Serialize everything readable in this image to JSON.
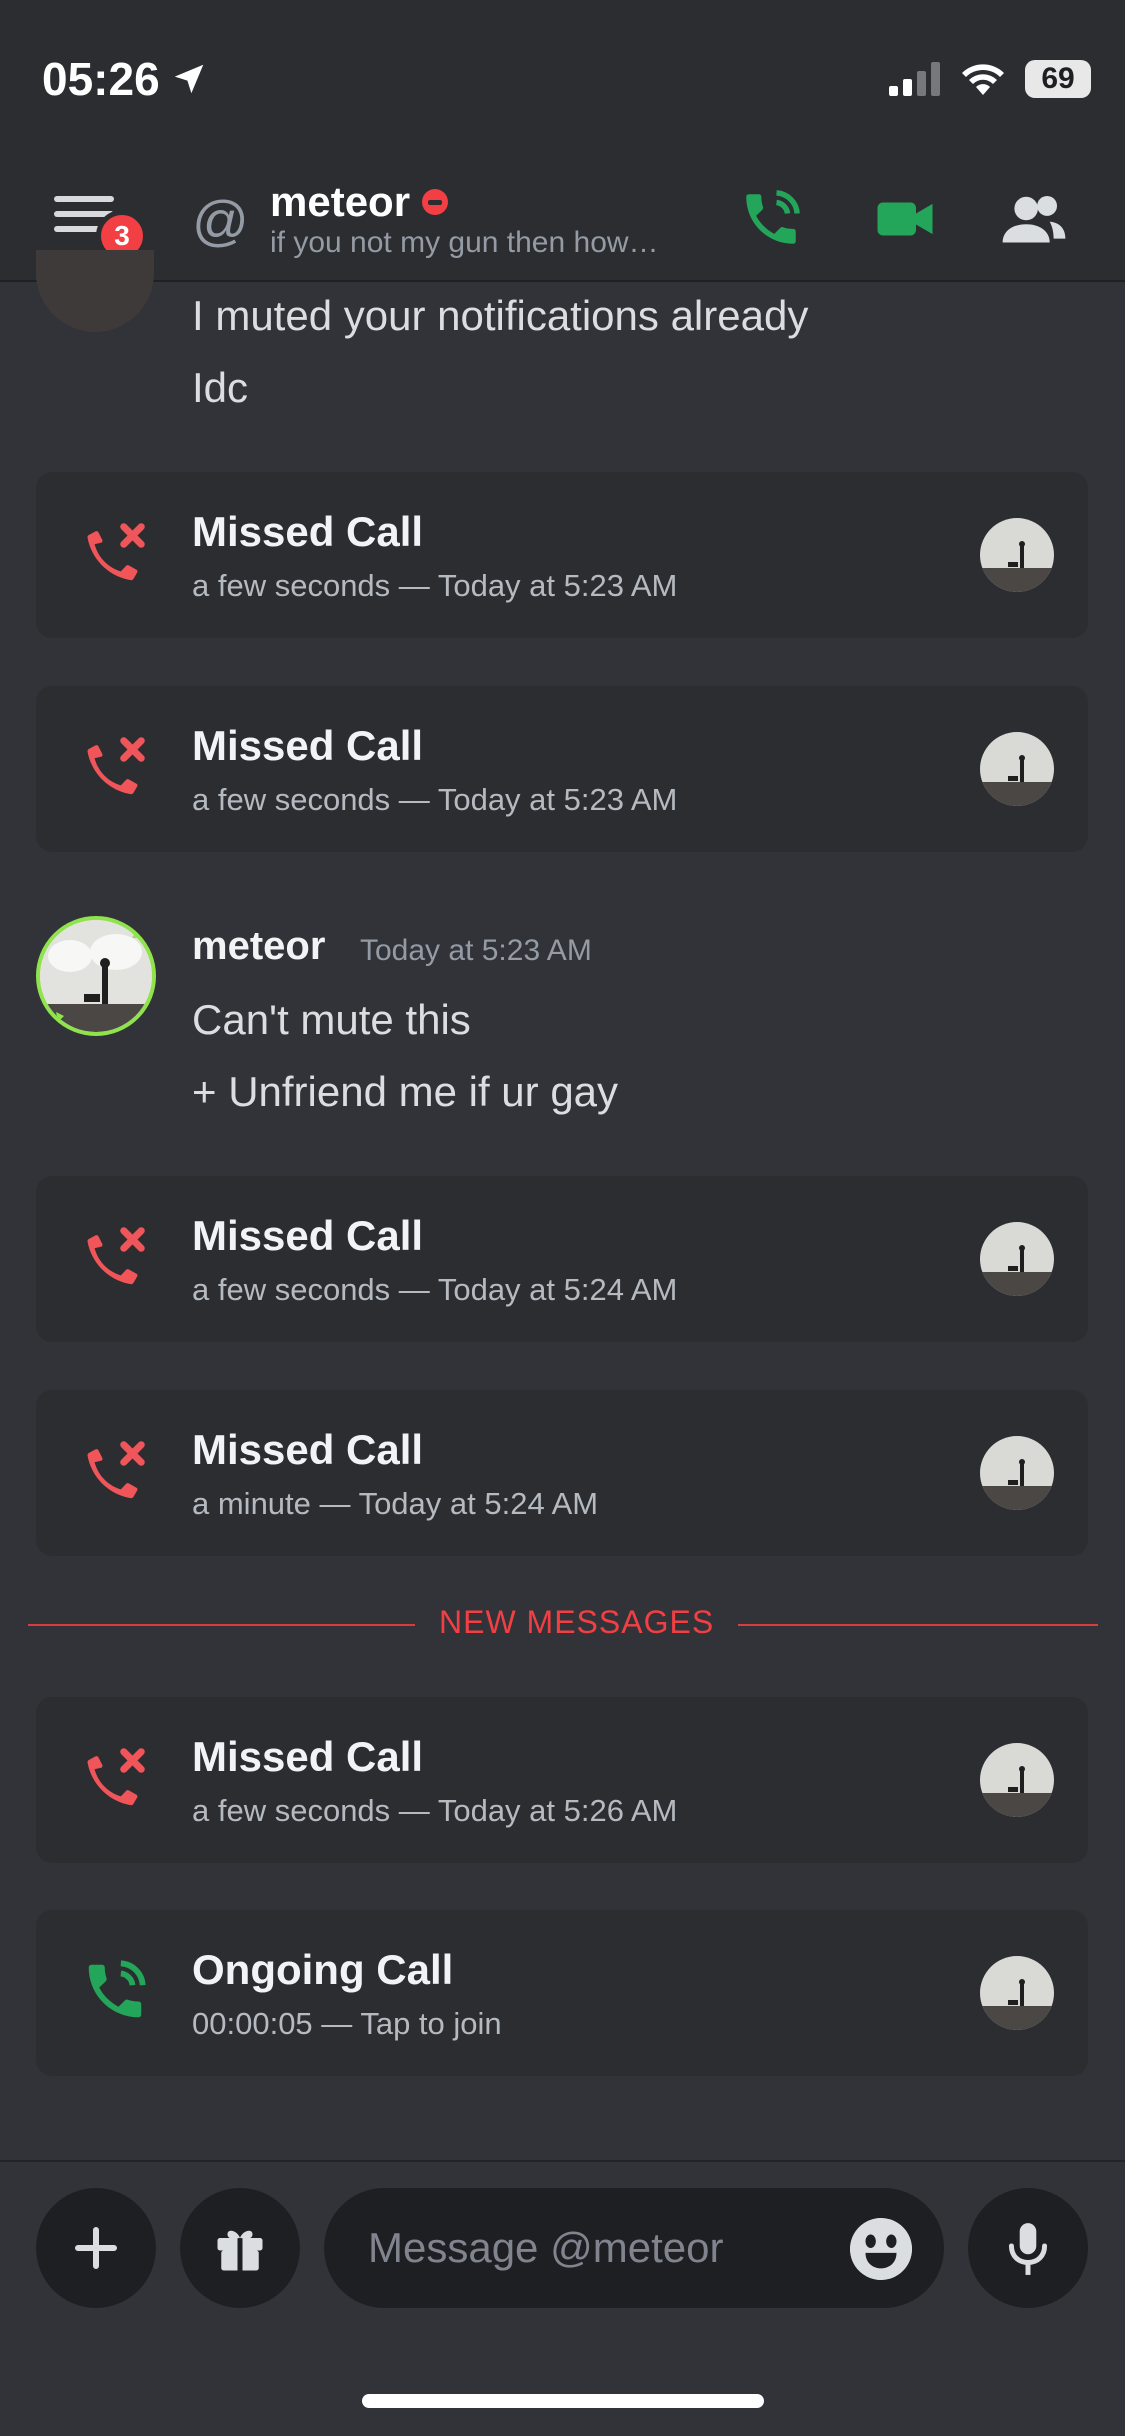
{
  "status_bar": {
    "time": "05:26",
    "battery": "69"
  },
  "header": {
    "badge_count": "3",
    "name": "meteor",
    "status_text": "if you not my gun then how…"
  },
  "messages": {
    "line1": "I muted your notifications already",
    "line2": "Idc"
  },
  "calls": [
    {
      "title": "Missed Call",
      "sub": "a few seconds — Today at 5:23 AM"
    },
    {
      "title": "Missed Call",
      "sub": "a few seconds — Today at 5:23 AM"
    },
    {
      "title": "Missed Call",
      "sub": "a few seconds — Today at 5:24 AM"
    },
    {
      "title": "Missed Call",
      "sub": "a minute — Today at 5:24 AM"
    },
    {
      "title": "Missed Call",
      "sub": "a few seconds — Today at 5:26 AM"
    },
    {
      "title": "Ongoing Call",
      "sub": "00:00:05 — Tap to join"
    }
  ],
  "author_message": {
    "name": "meteor",
    "time": "Today at 5:23 AM",
    "line1": "Can't mute this",
    "line2": "+ Unfriend me if ur gay"
  },
  "divider_label": "NEW MESSAGES",
  "composer": {
    "placeholder": "Message @meteor"
  },
  "colors": {
    "missed": "#f0555a",
    "ongoing": "#23a55a",
    "accent_red": "#f23f43"
  }
}
